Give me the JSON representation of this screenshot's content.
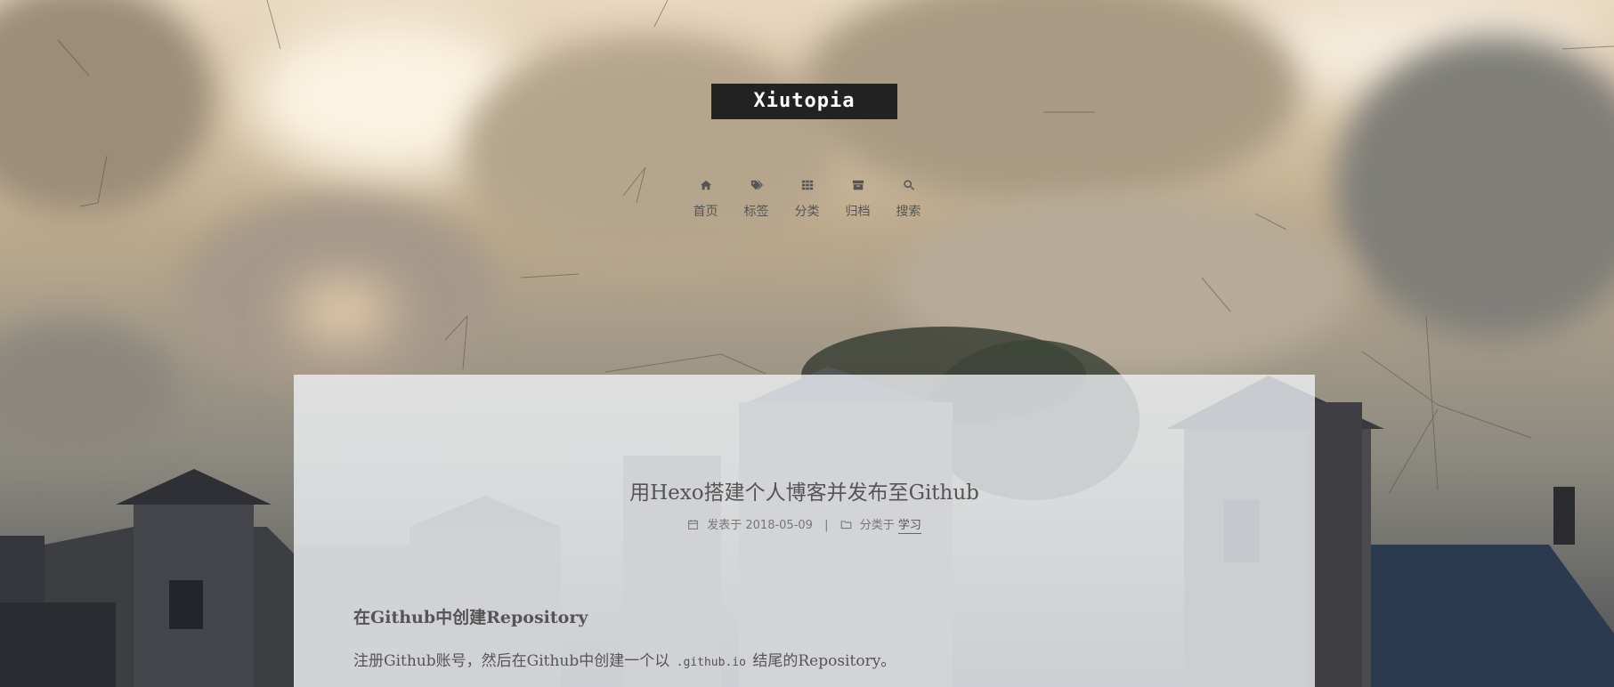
{
  "site": {
    "title": "Xiutopia"
  },
  "menu": [
    {
      "label": "首页",
      "icon": "home-icon"
    },
    {
      "label": "标签",
      "icon": "tags-icon"
    },
    {
      "label": "分类",
      "icon": "th-icon"
    },
    {
      "label": "归档",
      "icon": "archive-icon"
    },
    {
      "label": "搜索",
      "icon": "search-icon"
    }
  ],
  "post": {
    "title": "用Hexo搭建个人博客并发布至Github",
    "meta": {
      "published_prefix": "发表于",
      "date": "2018-05-09",
      "separator": "|",
      "category_prefix": "分类于",
      "category": "学习"
    },
    "section_heading": "在Github中创建Repository",
    "paragraph": {
      "before": "注册Github账号，然后在Github中创建一个以",
      "code": ".github.io",
      "after": "结尾的Repository。"
    }
  },
  "colors": {
    "brand_bg": "#222222",
    "brand_text": "#ffffff",
    "text": "#555555",
    "panel": "rgba(241,243,247,0.78)"
  }
}
